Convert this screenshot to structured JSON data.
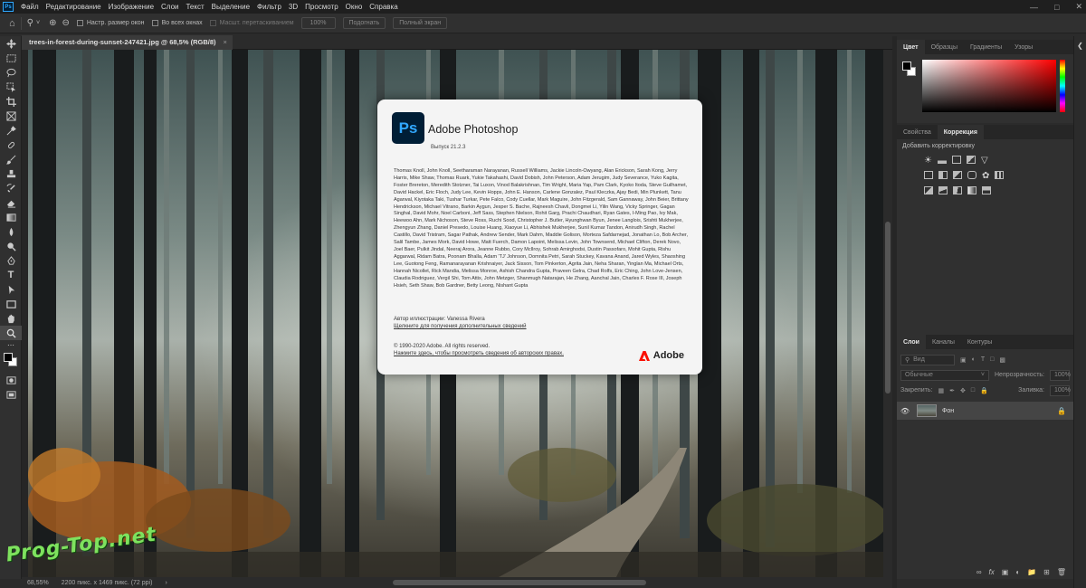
{
  "menubar": {
    "logo": "Ps",
    "items": [
      "Файл",
      "Редактирование",
      "Изображение",
      "Слои",
      "Текст",
      "Выделение",
      "Фильтр",
      "3D",
      "Просмотр",
      "Окно",
      "Справка"
    ]
  },
  "options_bar": {
    "resize_windows": "Настр. размер окон",
    "all_windows": "Во всех окнах",
    "scrubby_zoom": "Масшт. перетаскиванием",
    "zoom_value": "100%",
    "fit_screen": "Подогнать",
    "fill_screen": "Полный экран"
  },
  "document": {
    "tab_title": "trees-in-forest-during-sunset-247421.jpg @ 68,5% (RGB/8)",
    "close": "×"
  },
  "about_dialog": {
    "logo": "Ps",
    "title": "Adobe Photoshop",
    "version": "Выпуск 21.2.3",
    "credits": "Thomas Knoll, John Knoll, Seetharaman Narayanan, Russell Williams, Jackie Lincoln-Owyang, Alan Erickson, Sarah Kong, Jerry Harris, Mike Shaw, Thomas Ruark, Yukie Takahashi, David Dobish, John Peterson, Adam Jerugim, Judy Severance, Yuko Kagita, Foster Brereton, Meredith Stotzner, Tai Luxon, Vinod Balakrishnan, Tim Wright, Maria Yap, Pam Clark, Kyoko Itoda, Steve Guilhamet, David Hackel, Eric Floch, Judy Lee, Kevin Hopps, John E. Hanson, Carlene Gonzalez, Paul Kleczka, Ajay Bedi, Min Plunkett, Tanu Agarwal, Kiyotaka Taki, Tushar Turkar, Pete Falco, Cody Cuellar, Mark Maguire, John Fitzgerald, Sam Gannaway, John Beier, Brittany Hendrickson, Michael Vitrano, Barkin Aygun, Jesper S. Bache, Rajneesh Chavli, Dongmei Li, Yilin Wang, Vicky Springer, Gagan Singhal, David Mohr, Noel Carboni, Jeff Sass, Stephen Nielson, Rohit Garg, Prachi Chaudhari, Ryan Gates, I-Ming Pao, Ivy Mak, Heewoo Ahn, Mark Nichoson, Steve Ross, Ruchi Sood, Christopher J. Butler, Hyunghwan Byun, Jenee Langlois, Srishti Mukherjee, Zhengyun Zhang, Daniel Presedo, Louise Huang, Xiaoyue Li, Abhishek Mukherjee, Sunil Kumar Tandon, Anirudh Singh, Rachel Castillo, David Tristram, Sagar Pathak, Andrew Sender, Mark Dahm, Maddie Golison, Morteza Safdarnejad, Jonathan Lo, Bob Archer, Salil Tambe, James Mork, David Howe, Matt Fuerch, Damon Lapoint, Melissa Levin, John Townsend, Michael Clifton, Derek Novo, Joel Baer, Pulkit Jindal, Neeraj Arora, Jeanne Rubbo, Cory McIlroy, Sohrab Amirghodsi, Dustin Passofaro, Mohit Gupta, Rishu Aggarwal, Ridam Batra, Poonam Bhalla, Adam 'TJ' Johnson, Domnita Petri, Sarah Stuckey, Kavana Anand, Jared Wyles, Shaoshing Lee, Guotong Feng, Ramanarayanan Krishnaiyer, Jack Sisson, Tom Pinkerton, Agrita Jain, Neha Sharan, Yinglan Ma, Michael Orts, Hannah Nicollet, Rick Mandia, Melissa Monroe, Ashish Chandra Gupta, Praveen Gelra, Chad Rolfs, Eric Ching, John Love-Jensen, Claudia Rodriguez, Vergil Shi, Tom Attix, John Metzger, Shanmugh Natarajan, He Zhang, Aanchal Jain, Charles F. Rose III, Joseph Hsieh, Seth Shaw, Bob Gardner, Betty Leong, Nishant Gupta",
    "illustration_author": "Автор иллюстрации: Vanessa Rivera",
    "illustration_link": "Щелкните для получения дополнительных сведений",
    "copyright": "© 1990-2020 Adobe. All rights reserved.",
    "copyright_link": "Нажмите здесь, чтобы просмотреть сведения об авторских правах.",
    "brand": "Adobe"
  },
  "color_panel": {
    "tabs": [
      "Цвет",
      "Образцы",
      "Градиенты",
      "Узоры"
    ],
    "active_tab": "Цвет",
    "foreground": "#000000",
    "background": "#ffffff"
  },
  "adjustments_panel": {
    "tabs": [
      "Свойства",
      "Коррекция"
    ],
    "active_tab": "Коррекция",
    "label": "Добавить корректировку"
  },
  "layers_panel": {
    "tabs": [
      "Слои",
      "Каналы",
      "Контуры"
    ],
    "active_tab": "Слои",
    "kind_placeholder": "Вид",
    "blend_mode": "Обычные",
    "opacity_label": "Непрозрачность:",
    "opacity_value": "100%",
    "lock_label": "Закрепить:",
    "fill_label": "Заливка:",
    "fill_value": "100%",
    "layer_name": "Фон"
  },
  "status_bar": {
    "zoom": "68,55%",
    "doc_info": "2200 пикс. x 1469 пикс. (72 ppi)"
  },
  "watermark": "Prog-Top.net",
  "colors": {
    "ps_blue": "#31a8ff",
    "ps_dark": "#001e36",
    "adobe_red": "#fa0f00"
  }
}
